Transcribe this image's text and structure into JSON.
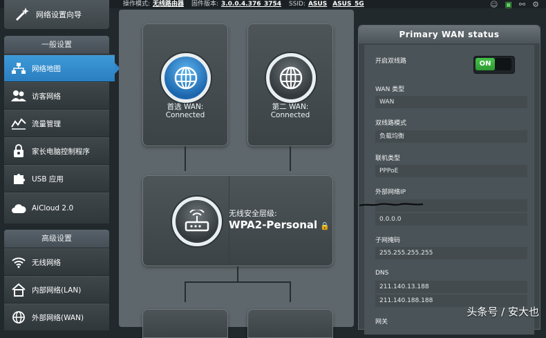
{
  "topbar": {
    "mode_label": "操作模式:",
    "mode_value": "无线路由器",
    "firmware_label": "固件版本:",
    "firmware_value": "3.0.0.4.376_3754",
    "ssid_label": "SSID:",
    "ssid_1": "ASUS",
    "ssid_2": "ASUS_5G",
    "icons": [
      "user-icon",
      "monitor-icon",
      "usb-icon",
      "settings-icon"
    ]
  },
  "sidebar": {
    "quick_setup": "网络设置向导",
    "general_title": "一般设置",
    "general_items": [
      {
        "label": "网络地图",
        "icon": "network-map-icon",
        "active": true
      },
      {
        "label": "访客网络",
        "icon": "guest-network-icon",
        "active": false
      },
      {
        "label": "流量管理",
        "icon": "traffic-manager-icon",
        "active": false
      },
      {
        "label": "家长电脑控制程序",
        "icon": "parental-control-icon",
        "active": false
      },
      {
        "label": "USB 应用",
        "icon": "usb-application-icon",
        "active": false
      },
      {
        "label": "AiCloud 2.0",
        "icon": "aicloud-icon",
        "active": false
      }
    ],
    "advanced_title": "高级设置",
    "advanced_items": [
      {
        "label": "无线网络",
        "icon": "wireless-icon"
      },
      {
        "label": "内部网络(LAN)",
        "icon": "lan-icon"
      },
      {
        "label": "外部网络(WAN)",
        "icon": "wan-icon"
      }
    ]
  },
  "map": {
    "wan1_title": "首选 WAN:",
    "wan1_status": "Connected",
    "wan2_title": "第二 WAN:",
    "wan2_status": "Connected",
    "security_label": "无线安全层级:",
    "security_value": "WPA2-Personal"
  },
  "panel": {
    "title": "Primary WAN status",
    "dual_wan_label": "开启双线路",
    "toggle_state": "ON",
    "wan_type_label": "WAN 类型",
    "wan_type_value": "WAN",
    "dual_mode_label": "双线路模式",
    "dual_mode_value": "负载均衡",
    "conn_type_label": "联机类型",
    "conn_type_value": "PPPoE",
    "ext_ip_label": "外部网络IP",
    "ext_ip_value_2": "0.0.0.0",
    "subnet_label": "子网掩码",
    "subnet_value": "255.255.255.255",
    "dns_label": "DNS",
    "dns_1": "211.140.13.188",
    "dns_2": "211.140.188.188",
    "gateway_label": "网关"
  },
  "watermark": "头条号 / 安大也",
  "colors": {
    "active_blue": "#2f86c8",
    "toggle_green": "#3cb341",
    "background": "#22292c"
  }
}
